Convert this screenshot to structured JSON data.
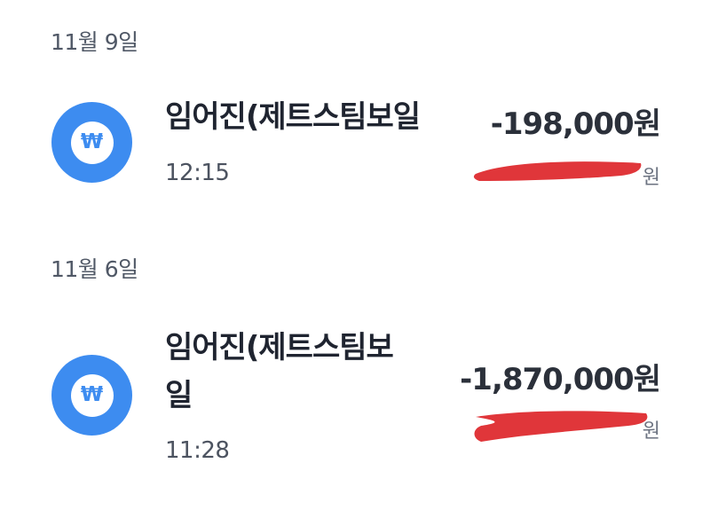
{
  "groups": [
    {
      "date": "11월 9일",
      "transaction": {
        "icon": "won-icon",
        "name": "임어진(제트스팀보일",
        "time": "12:15",
        "amount": "-198,000원",
        "balance_hint": "원"
      }
    },
    {
      "date": "11월 6일",
      "transaction": {
        "icon": "won-icon",
        "name_line1": "임어진(제트스팀보",
        "name_line2": "일",
        "time": "11:28",
        "amount": "-1,870,000원",
        "balance_hint": "원"
      }
    }
  ],
  "icon_symbol": "₩",
  "colors": {
    "accent": "#3d8cf0",
    "redaction": "#e0363a",
    "text_primary": "#1f2430",
    "text_secondary": "#505866"
  }
}
